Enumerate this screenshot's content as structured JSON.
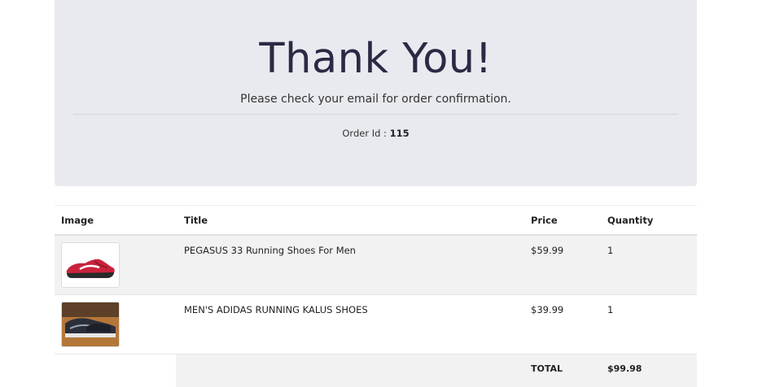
{
  "header": {
    "title": "Thank You!",
    "subtitle": "Please check your email for order confirmation.",
    "order_label": "Order Id :",
    "order_id": "115"
  },
  "table": {
    "columns": [
      "Image",
      "Title",
      "Price",
      "Quantity"
    ],
    "items": [
      {
        "title": "PEGASUS 33 Running Shoes For Men",
        "price": "$59.99",
        "quantity": "1",
        "image_icon": "red-running-shoe-image"
      },
      {
        "title": "MEN'S ADIDAS RUNNING KALUS SHOES",
        "price": "$39.99",
        "quantity": "1",
        "image_icon": "dark-running-shoes-image"
      }
    ],
    "total_label": "TOTAL",
    "total_value": "$99.98"
  }
}
